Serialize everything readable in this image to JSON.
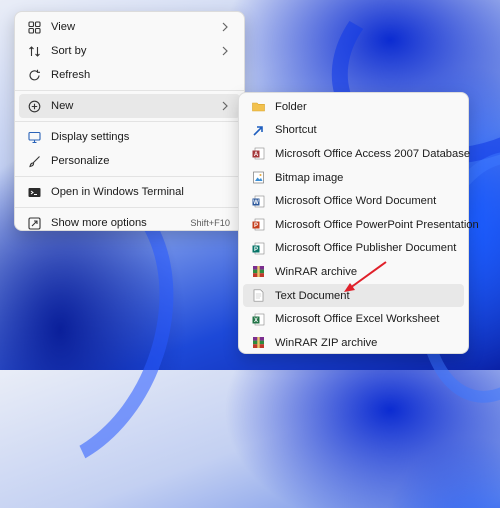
{
  "context_menu": {
    "items": [
      {
        "label": "View",
        "icon": "view-grid-icon"
      },
      {
        "label": "Sort by",
        "icon": "sort-icon"
      },
      {
        "label": "Refresh",
        "icon": "refresh-icon"
      },
      {
        "label": "New",
        "icon": "new-plus-icon"
      },
      {
        "label": "Display settings",
        "icon": "display-icon"
      },
      {
        "label": "Personalize",
        "icon": "brush-icon"
      },
      {
        "label": "Open in Windows Terminal",
        "icon": "terminal-icon"
      },
      {
        "label": "Show more options",
        "icon": "more-options-icon",
        "shortcut": "Shift+F10"
      }
    ]
  },
  "new_submenu": {
    "items": [
      {
        "label": "Folder",
        "icon": "folder-icon"
      },
      {
        "label": "Shortcut",
        "icon": "shortcut-icon"
      },
      {
        "label": "Microsoft Office Access 2007 Database",
        "icon": "access-icon"
      },
      {
        "label": "Bitmap image",
        "icon": "bitmap-icon"
      },
      {
        "label": "Microsoft Office Word Document",
        "icon": "word-icon"
      },
      {
        "label": "Microsoft Office PowerPoint Presentation",
        "icon": "powerpoint-icon"
      },
      {
        "label": "Microsoft Office Publisher Document",
        "icon": "publisher-icon"
      },
      {
        "label": "WinRAR archive",
        "icon": "winrar-icon"
      },
      {
        "label": "Text Document",
        "icon": "text-document-icon"
      },
      {
        "label": "Microsoft Office Excel Worksheet",
        "icon": "excel-icon"
      },
      {
        "label": "WinRAR ZIP archive",
        "icon": "winrar-zip-icon"
      }
    ]
  },
  "colors": {
    "menu_bg": "#f9f9f9",
    "hover_bg": "#e8e8e8",
    "annotation_arrow": "#e0202a"
  }
}
